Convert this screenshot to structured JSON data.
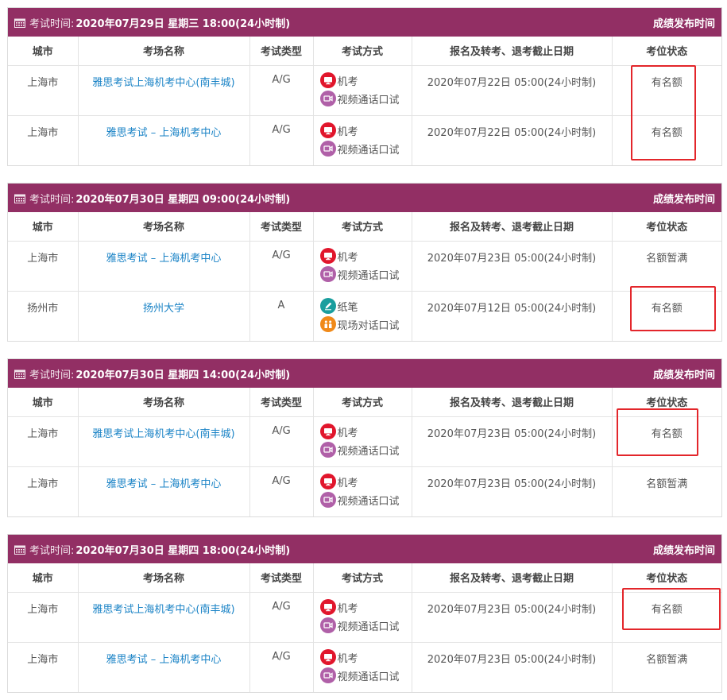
{
  "header_label": "考试时间:",
  "publish_label": "成绩发布时间",
  "columns": [
    "城市",
    "考场名称",
    "考试类型",
    "考试方式",
    "报名及转考、退考截止日期",
    "考位状态"
  ],
  "colors": {
    "header_bg": "#922f64",
    "link": "#1a83c6",
    "highlight": "#e3262b"
  },
  "sessions": [
    {
      "datetime": "2020年07月29日 星期三 18:00(24小时制)",
      "rows": [
        {
          "city": "上海市",
          "venue": "雅思考试上海机考中心(南丰城)",
          "type": "A/G",
          "modes": [
            {
              "icon": "computer-icon",
              "label": "机考"
            },
            {
              "icon": "video-call-icon",
              "label": "视频通话口试"
            }
          ],
          "deadline": "2020年07月22日 05:00(24小时制)",
          "status": "有名额"
        },
        {
          "city": "上海市",
          "venue": "雅思考试 – 上海机考中心",
          "type": "A/G",
          "modes": [
            {
              "icon": "computer-icon",
              "label": "机考"
            },
            {
              "icon": "video-call-icon",
              "label": "视频通话口试"
            }
          ],
          "deadline": "2020年07月22日 05:00(24小时制)",
          "status": "有名额"
        }
      ]
    },
    {
      "datetime": "2020年07月30日 星期四 09:00(24小时制)",
      "rows": [
        {
          "city": "上海市",
          "venue": "雅思考试 – 上海机考中心",
          "type": "A/G",
          "modes": [
            {
              "icon": "computer-icon",
              "label": "机考"
            },
            {
              "icon": "video-call-icon",
              "label": "视频通话口试"
            }
          ],
          "deadline": "2020年07月23日 05:00(24小时制)",
          "status": "名额暂满"
        },
        {
          "city": "扬州市",
          "venue": "扬州大学",
          "type": "A",
          "modes": [
            {
              "icon": "pencil-icon",
              "label": "纸笔"
            },
            {
              "icon": "face-to-face-icon",
              "label": "现场对话口试"
            }
          ],
          "deadline": "2020年07月12日 05:00(24小时制)",
          "status": "有名额"
        }
      ]
    },
    {
      "datetime": "2020年07月30日 星期四 14:00(24小时制)",
      "rows": [
        {
          "city": "上海市",
          "venue": "雅思考试上海机考中心(南丰城)",
          "type": "A/G",
          "modes": [
            {
              "icon": "computer-icon",
              "label": "机考"
            },
            {
              "icon": "video-call-icon",
              "label": "视频通话口试"
            }
          ],
          "deadline": "2020年07月23日 05:00(24小时制)",
          "status": "有名额"
        },
        {
          "city": "上海市",
          "venue": "雅思考试 – 上海机考中心",
          "type": "A/G",
          "modes": [
            {
              "icon": "computer-icon",
              "label": "机考"
            },
            {
              "icon": "video-call-icon",
              "label": "视频通话口试"
            }
          ],
          "deadline": "2020年07月23日 05:00(24小时制)",
          "status": "名额暂满"
        }
      ]
    },
    {
      "datetime": "2020年07月30日 星期四 18:00(24小时制)",
      "rows": [
        {
          "city": "上海市",
          "venue": "雅思考试上海机考中心(南丰城)",
          "type": "A/G",
          "modes": [
            {
              "icon": "computer-icon",
              "label": "机考"
            },
            {
              "icon": "video-call-icon",
              "label": "视频通话口试"
            }
          ],
          "deadline": "2020年07月23日 05:00(24小时制)",
          "status": "有名额"
        },
        {
          "city": "上海市",
          "venue": "雅思考试 – 上海机考中心",
          "type": "A/G",
          "modes": [
            {
              "icon": "computer-icon",
              "label": "机考"
            },
            {
              "icon": "video-call-icon",
              "label": "视频通话口试"
            }
          ],
          "deadline": "2020年07月23日 05:00(24小时制)",
          "status": "名额暂满"
        }
      ]
    }
  ]
}
